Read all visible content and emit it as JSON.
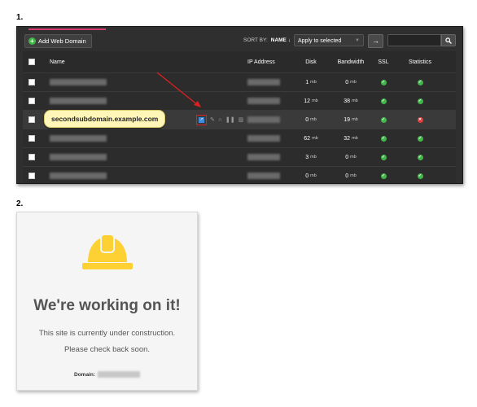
{
  "steps": [
    "1.",
    "2."
  ],
  "toolbar": {
    "add_label": "Add Web Domain",
    "sort_by_label": "SORT BY:",
    "sort_by_value": "NAME ↓",
    "bulk_action": "Apply to selected",
    "go_symbol": "→",
    "search_symbol": "🔍"
  },
  "table": {
    "headers": [
      "Name",
      "IP Address",
      "Disk",
      "Bandwidth",
      "SSL",
      "Statistics"
    ],
    "rows": [
      {
        "disk": "1",
        "bandwidth": "0",
        "ssl": "ok",
        "stats": "ok"
      },
      {
        "disk": "12",
        "bandwidth": "38",
        "ssl": "ok",
        "stats": "ok"
      },
      {
        "disk": "0",
        "bandwidth": "19",
        "ssl": "ok",
        "stats": "error"
      },
      {
        "disk": "62",
        "bandwidth": "32",
        "ssl": "ok",
        "stats": "ok"
      },
      {
        "disk": "3",
        "bandwidth": "0",
        "ssl": "ok",
        "stats": "ok"
      },
      {
        "disk": "0",
        "bandwidth": "0",
        "ssl": "ok",
        "stats": "ok"
      }
    ],
    "unit": "mb"
  },
  "tooltip": "secondsubdomain.example.com",
  "colors": {
    "accent": "#d63a6e",
    "ok": "#43b649",
    "error": "#e03b3b",
    "annotation": "#e02020",
    "hardhat": "#fdd033"
  },
  "construction": {
    "heading": "We're working on it!",
    "line1": "This site is currently under construction.",
    "line2": "Please check back soon.",
    "domain_label": "Domain:"
  }
}
